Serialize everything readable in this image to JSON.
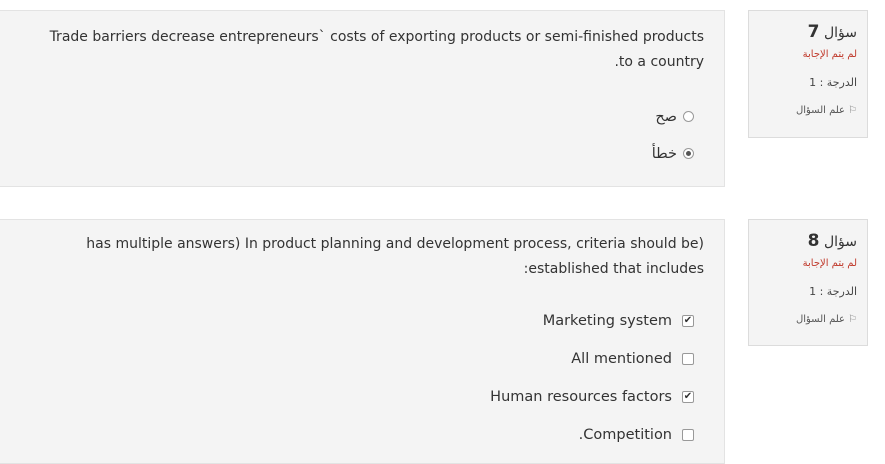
{
  "questions": [
    {
      "info": {
        "label": "سؤال",
        "number": "7",
        "state": "لم يتم الإجابة",
        "grade": "الدرجة : 1",
        "flag": "علم السؤال"
      },
      "text_line1": "Trade barriers decrease entrepreneurs` costs of exporting products or semi-finished products",
      "text_line2": ".to a country",
      "options": [
        {
          "label": "صح",
          "checked": false
        },
        {
          "label": "خطأ",
          "checked": true
        }
      ]
    },
    {
      "info": {
        "label": "سؤال",
        "number": "8",
        "state": "لم يتم الإجابة",
        "grade": "الدرجة : 1",
        "flag": "علم السؤال"
      },
      "text_line1": "has multiple answers) In product planning and development process,  criteria should be)",
      "text_line2": ":established that includes",
      "options": [
        {
          "label": "Marketing system",
          "checked": true
        },
        {
          "label": "All mentioned",
          "checked": false
        },
        {
          "label": "Human resources factors",
          "checked": true
        },
        {
          "label": ".Competition",
          "checked": false
        }
      ]
    }
  ],
  "icons": {
    "flag": "flag-icon",
    "check": "checkmark-icon"
  }
}
